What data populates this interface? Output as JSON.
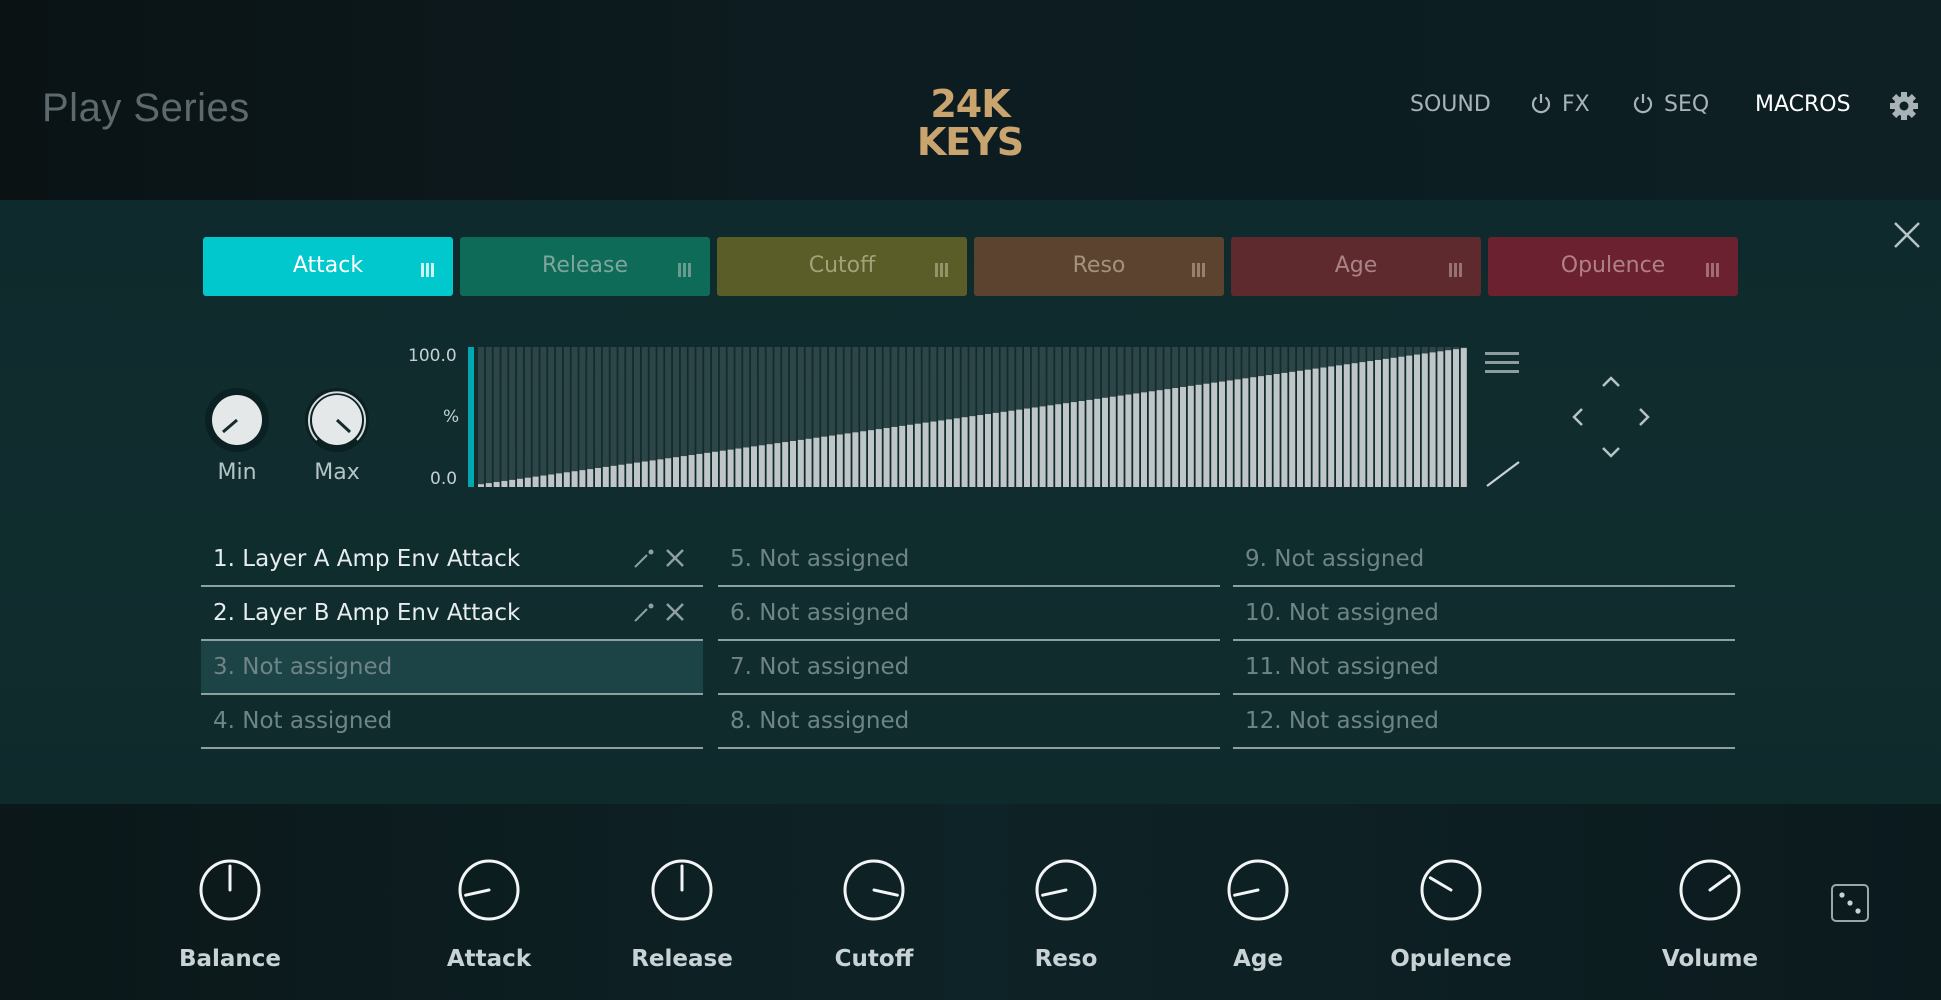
{
  "header": {
    "brand": "Play Series",
    "logo_line1": "24K",
    "logo_line2": "KEYS",
    "nav": [
      {
        "label": "SOUND",
        "power": false,
        "active": false
      },
      {
        "label": "FX",
        "power": true,
        "active": false
      },
      {
        "label": "SEQ",
        "power": true,
        "active": false
      },
      {
        "label": "MACROS",
        "power": false,
        "active": true
      }
    ],
    "settings_icon": "gear-icon"
  },
  "panel": {
    "close_icon": "close-icon",
    "tabs": [
      {
        "label": "Attack",
        "color": "#00c8cc",
        "text_color": "#ffffff"
      },
      {
        "label": "Release",
        "color": "#0e6b58",
        "text_color": "#7fa69c"
      },
      {
        "label": "Cutoff",
        "color": "#5a5d27",
        "text_color": "#a1a27a"
      },
      {
        "label": "Reso",
        "color": "#5b4330",
        "text_color": "#a4917e"
      },
      {
        "label": "Age",
        "color": "#5e2a2e",
        "text_color": "#a98385"
      },
      {
        "label": "Opulence",
        "color": "#6c2130",
        "text_color": "#b08088"
      }
    ],
    "range_knobs": {
      "min_label": "Min",
      "max_label": "Max"
    },
    "step_editor": {
      "y_max_label": "100.0",
      "y_unit_label": "%",
      "y_min_label": "0.0",
      "step_count": 128,
      "start_percent": 2,
      "end_percent": 100,
      "bar_color": "#c0c6c8",
      "accent_color": "#00a9b0"
    },
    "slots": [
      {
        "label": "1. Layer A Amp Env Attack",
        "assigned": true
      },
      {
        "label": "2. Layer B Amp Env Attack",
        "assigned": true
      },
      {
        "label": "3. Not assigned",
        "assigned": false,
        "selected": true
      },
      {
        "label": "4. Not assigned",
        "assigned": false
      },
      {
        "label": "5. Not assigned",
        "assigned": false
      },
      {
        "label": "6. Not assigned",
        "assigned": false
      },
      {
        "label": "7. Not assigned",
        "assigned": false
      },
      {
        "label": "8. Not assigned",
        "assigned": false
      },
      {
        "label": "9. Not assigned",
        "assigned": false
      },
      {
        "label": "10. Not assigned",
        "assigned": false
      },
      {
        "label": "11. Not assigned",
        "assigned": false
      },
      {
        "label": "12. Not assigned",
        "assigned": false
      }
    ]
  },
  "macros": [
    {
      "label": "Balance",
      "value": 0.5
    },
    {
      "label": "Attack",
      "value": 0.12
    },
    {
      "label": "Release",
      "value": 0.5
    },
    {
      "label": "Cutoff",
      "value": 0.88
    },
    {
      "label": "Reso",
      "value": 0.12
    },
    {
      "label": "Age",
      "value": 0.12
    },
    {
      "label": "Opulence",
      "value": 0.28
    },
    {
      "label": "Volume",
      "value": 0.7
    }
  ],
  "randomize_icon": "dice-icon"
}
